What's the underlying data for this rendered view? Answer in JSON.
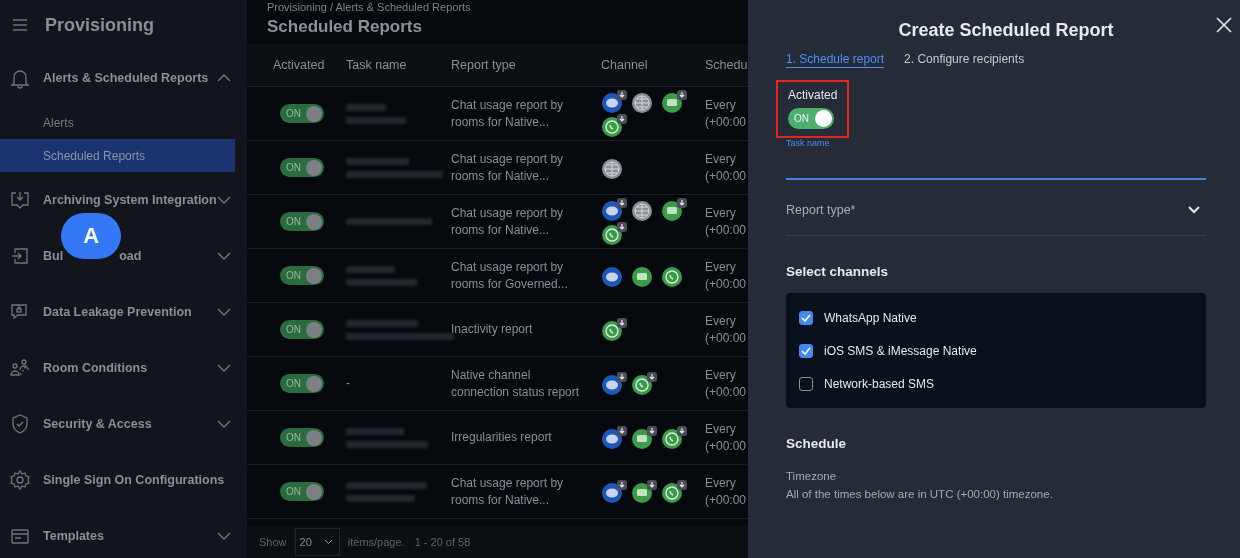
{
  "sidebar": {
    "title": "Provisioning",
    "groups": [
      {
        "label": "Alerts & Scheduled Reports",
        "kind": "bell",
        "expanded": true,
        "children": [
          {
            "label": "Alerts",
            "selected": false
          },
          {
            "label": "Scheduled Reports",
            "selected": true
          }
        ]
      },
      {
        "label": "Archiving System Integration",
        "kind": "tray",
        "expanded": false
      },
      {
        "label": "Bul",
        "label_tail": "oad",
        "kind": "import",
        "expanded": false,
        "marker": "A"
      },
      {
        "label": "Data Leakage Prevention",
        "kind": "lock-chat",
        "expanded": false
      },
      {
        "label": "Room Conditions",
        "kind": "people",
        "expanded": false
      },
      {
        "label": "Security & Access",
        "kind": "shield",
        "expanded": false
      },
      {
        "label": "Single Sign On Configurations",
        "kind": "gear"
      },
      {
        "label": "Templates",
        "kind": "card",
        "expanded": false
      }
    ]
  },
  "breadcrumb": "Provisioning / Alerts & Scheduled Reports",
  "page_title": "Scheduled Reports",
  "table": {
    "columns": [
      "Activated",
      "Task name",
      "Report type",
      "Channel",
      "Schedu"
    ],
    "rows": [
      {
        "on": true,
        "toggle_label": "ON",
        "task_redacted": true,
        "report_type": "Chat usage report by rooms for Native...",
        "channels": [
          {
            "kind": "imessage",
            "download": true
          },
          {
            "kind": "network-sms",
            "download": false
          },
          {
            "kind": "sms",
            "download": true
          },
          {
            "kind": "whatsapp",
            "download": true
          }
        ],
        "schedule": [
          "Every",
          "(+00:00"
        ]
      },
      {
        "on": true,
        "toggle_label": "ON",
        "task_redacted": true,
        "report_type": "Chat usage report by rooms for Native...",
        "channels": [
          {
            "kind": "network-sms",
            "download": false
          }
        ],
        "schedule": [
          "Every",
          "(+00:00"
        ]
      },
      {
        "on": true,
        "toggle_label": "ON",
        "task_redacted": true,
        "report_type": "Chat usage report by rooms for Native...",
        "channels": [
          {
            "kind": "imessage",
            "download": true
          },
          {
            "kind": "network-sms",
            "download": false
          },
          {
            "kind": "sms",
            "download": true
          },
          {
            "kind": "whatsapp",
            "download": true
          }
        ],
        "schedule": [
          "Every",
          "(+00:00"
        ]
      },
      {
        "on": true,
        "toggle_label": "ON",
        "task_redacted": true,
        "report_type": "Chat usage report by rooms for Governed...",
        "channels": [
          {
            "kind": "imessage",
            "download": false
          },
          {
            "kind": "sms",
            "download": false
          },
          {
            "kind": "whatsapp",
            "download": false
          }
        ],
        "schedule": [
          "Every",
          "(+00:00"
        ]
      },
      {
        "on": true,
        "toggle_label": "ON",
        "task_redacted": true,
        "report_type": "Inactivity report",
        "channels": [
          {
            "kind": "whatsapp",
            "download": true
          }
        ],
        "schedule": [
          "Every",
          "(+00:00"
        ]
      },
      {
        "on": true,
        "toggle_label": "ON",
        "task_redacted": false,
        "task_name": "-",
        "report_type": "Native channel connection status report",
        "channels": [
          {
            "kind": "imessage",
            "download": true
          },
          {
            "kind": "whatsapp",
            "download": true
          }
        ],
        "schedule": [
          "Every",
          "(+00:00"
        ]
      },
      {
        "on": true,
        "toggle_label": "ON",
        "task_redacted": true,
        "report_type": "Irregularities report",
        "channels": [
          {
            "kind": "imessage",
            "download": true
          },
          {
            "kind": "sms",
            "download": true
          },
          {
            "kind": "whatsapp",
            "download": true
          }
        ],
        "schedule": [
          "Every",
          "(+00:00"
        ]
      },
      {
        "on": true,
        "toggle_label": "ON",
        "task_redacted": true,
        "report_type": "Chat usage report by rooms for Native...",
        "channels": [
          {
            "kind": "imessage",
            "download": true
          },
          {
            "kind": "sms",
            "download": true
          },
          {
            "kind": "whatsapp",
            "download": true
          }
        ],
        "schedule": [
          "Every",
          "(+00:00"
        ]
      }
    ]
  },
  "pagination": {
    "show": "Show",
    "page_size": "20",
    "per_page": "items/page.",
    "range": "1 - 20 of 58"
  },
  "drawer": {
    "title": "Create Scheduled Report",
    "steps": [
      {
        "label": "1. Schedule report",
        "selected": true
      },
      {
        "label": "2. Configure recipients",
        "selected": false
      }
    ],
    "activated": {
      "label": "Activated",
      "on": true,
      "toggle_label": "ON",
      "highlighted": true
    },
    "task_name": {
      "label": "Task name",
      "focused": true
    },
    "report_type": {
      "placeholder": "Report type*"
    },
    "channels_title": "Select channels",
    "channels": [
      {
        "label": "WhatsApp Native",
        "checked": true
      },
      {
        "label": "iOS SMS & iMessage Native",
        "checked": true
      },
      {
        "label": "Network-based SMS",
        "checked": false
      }
    ],
    "schedule_title": "Schedule",
    "timezone_label": "Timezone",
    "timezone_note": "All of the times below are in UTC (+00:00) timezone."
  }
}
